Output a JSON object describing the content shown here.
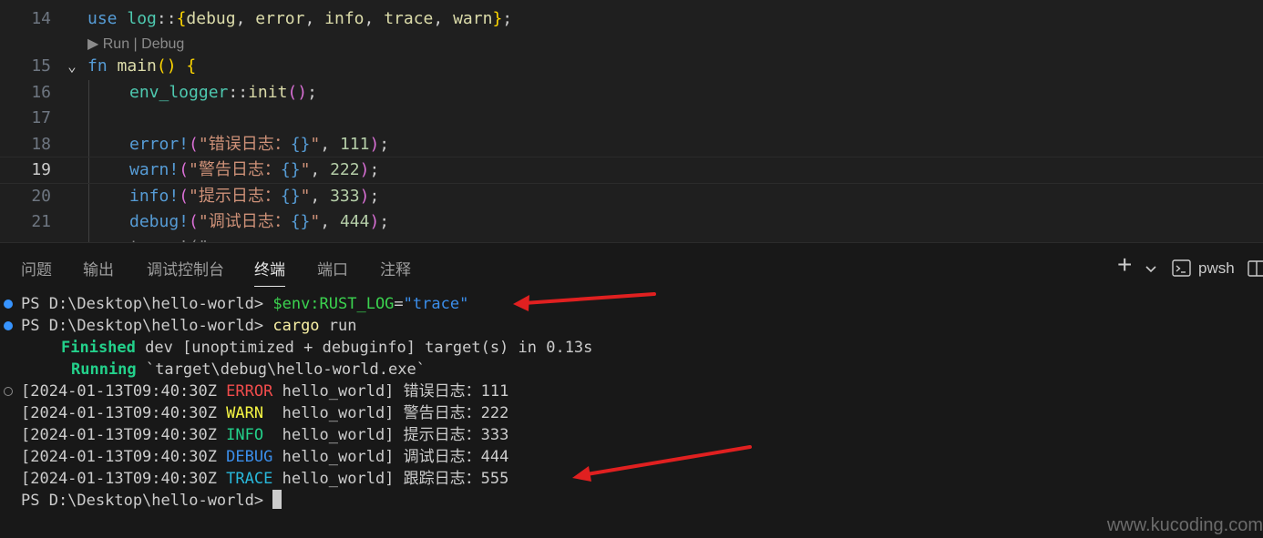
{
  "editor": {
    "code_lens": "▶ Run | Debug",
    "lines": [
      {
        "no": "14",
        "text": "use log::{debug, error, info, trace, warn};"
      },
      {
        "no": "15",
        "text": "fn main() {"
      },
      {
        "no": "16",
        "text": "env_logger::init();"
      },
      {
        "no": "17",
        "text": ""
      },
      {
        "no": "18",
        "text": "error!(\"错误日志：{}\", 111);"
      },
      {
        "no": "19",
        "text": "warn!(\"警告日志：{}\", 222);"
      },
      {
        "no": "20",
        "text": "info!(\"提示日志：{}\", 333);"
      },
      {
        "no": "21",
        "text": "debug!(\"调试日志：{}\", 444);"
      }
    ]
  },
  "panel": {
    "tabs": [
      "问题",
      "输出",
      "调试控制台",
      "终端",
      "端口",
      "注释"
    ],
    "active_tab": "终端",
    "new_terminal": "+",
    "shell_name": "pwsh"
  },
  "terminal": {
    "prompt": "PS D:\\Desktop\\hello-world>",
    "cmd1_var": "$env:RUST_LOG",
    "cmd1_eq": "=",
    "cmd1_val": "\"trace\"",
    "cmd2_name": "cargo",
    "cmd2_arg": " run",
    "finished_label": "Finished",
    "finished_rest": " dev [unoptimized + debuginfo] target(s) in 0.13s",
    "running_label": "Running",
    "running_rest": " `target\\debug\\hello-world.exe`",
    "logs": [
      {
        "ts": "[2024-01-13T09:40:30Z ",
        "level": "ERROR",
        "target": " hello_world] ",
        "msg": "错误日志：111"
      },
      {
        "ts": "[2024-01-13T09:40:30Z ",
        "level": "WARN ",
        "target": " hello_world] ",
        "msg": "警告日志：222"
      },
      {
        "ts": "[2024-01-13T09:40:30Z ",
        "level": "INFO ",
        "target": " hello_world] ",
        "msg": "提示日志：333"
      },
      {
        "ts": "[2024-01-13T09:40:30Z ",
        "level": "DEBUG",
        "target": " hello_world] ",
        "msg": "调试日志：444"
      },
      {
        "ts": "[2024-01-13T09:40:30Z ",
        "level": "TRACE",
        "target": " hello_world] ",
        "msg": "跟踪日志：555"
      }
    ]
  },
  "watermark": "www.kucoding.com",
  "colors": {
    "annotation_arrow": "#e02020",
    "error": "#f14c4c",
    "warn": "#f5f543",
    "info": "#23d18b",
    "debug": "#3b8eea",
    "trace": "#29b8db"
  }
}
